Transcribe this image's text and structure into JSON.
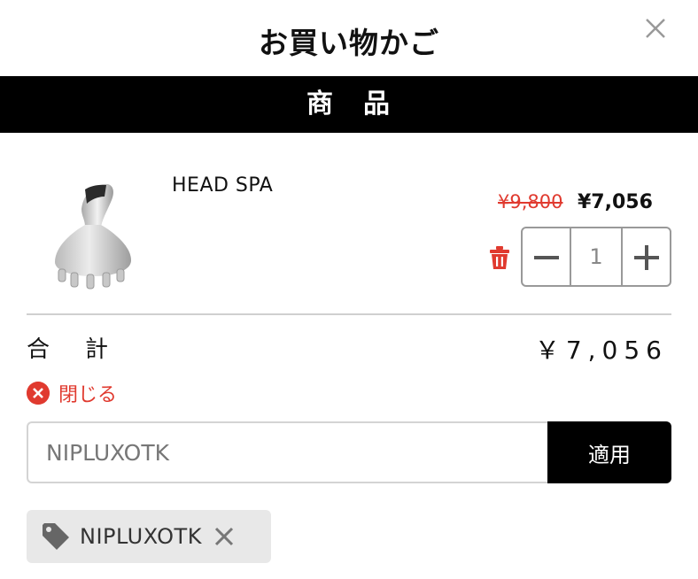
{
  "header": {
    "title": "お買い物かご",
    "close_icon": "close-icon"
  },
  "section": {
    "title": "商　品"
  },
  "item": {
    "name": "HEAD SPA",
    "original_price": "¥9,800",
    "sale_price": "¥7,056",
    "quantity": "1",
    "image_icon": "head-spa-device-image"
  },
  "summary": {
    "total_label_first": "合",
    "total_label_second": "計",
    "total_value": "￥7,056"
  },
  "coupon": {
    "close_label": "閉じる",
    "input_value": "NIPLUXOTK",
    "apply_label": "適用",
    "applied_code": "NIPLUXOTK"
  },
  "colors": {
    "accent_red": "#e03a2f",
    "bar_black": "#000000",
    "tag_bg": "#e8e8e8"
  }
}
